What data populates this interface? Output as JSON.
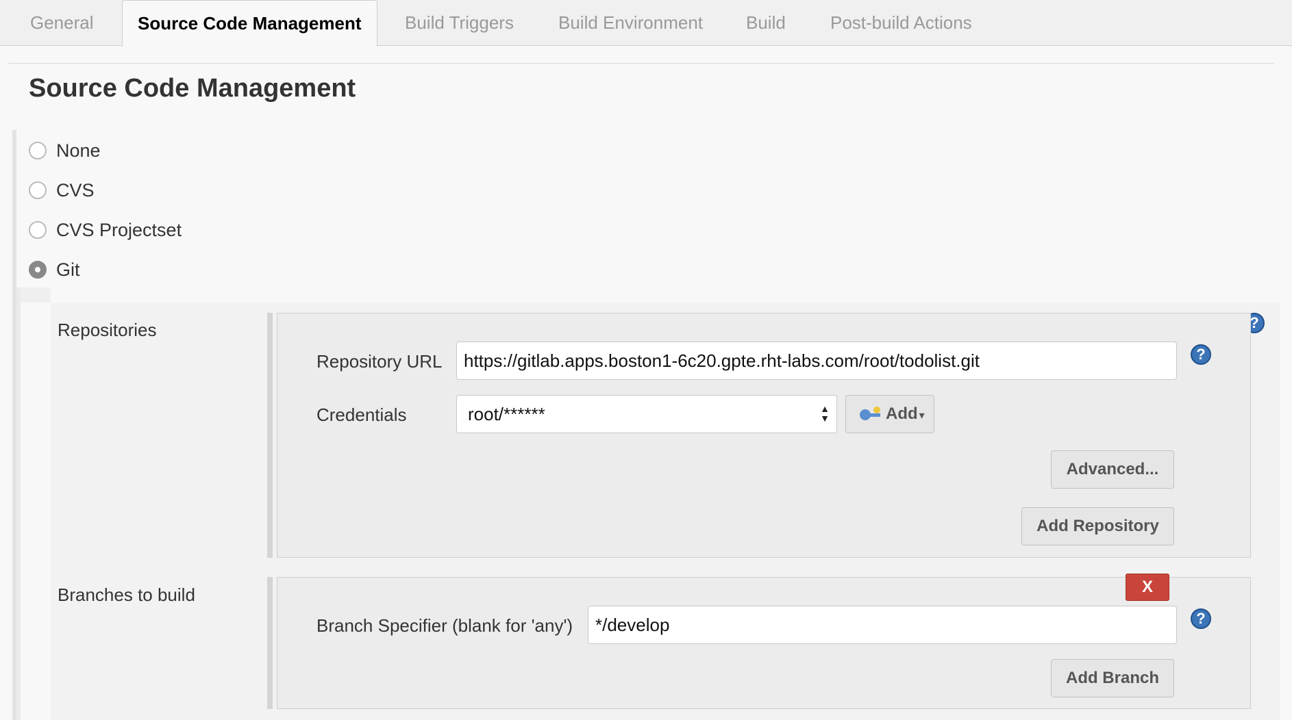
{
  "tabs": [
    {
      "label": "General",
      "active": false
    },
    {
      "label": "Source Code Management",
      "active": true
    },
    {
      "label": "Build Triggers",
      "active": false
    },
    {
      "label": "Build Environment",
      "active": false
    },
    {
      "label": "Build",
      "active": false
    },
    {
      "label": "Post-build Actions",
      "active": false
    }
  ],
  "section": {
    "title": "Source Code Management"
  },
  "scm_options": [
    {
      "label": "None",
      "checked": false
    },
    {
      "label": "CVS",
      "checked": false
    },
    {
      "label": "CVS Projectset",
      "checked": false
    },
    {
      "label": "Git",
      "checked": true
    }
  ],
  "repositories": {
    "label": "Repositories",
    "url_label": "Repository URL",
    "url_value": "https://gitlab.apps.boston1-6c20.gpte.rht-labs.com/root/todolist.git",
    "credentials_label": "Credentials",
    "credentials_value": "root/******",
    "add_label": "Add",
    "advanced_label": "Advanced...",
    "add_repository_label": "Add Repository"
  },
  "branches": {
    "label": "Branches to build",
    "delete_label": "X",
    "specifier_label": "Branch Specifier (blank for 'any')",
    "specifier_value": "*/develop",
    "add_branch_label": "Add Branch"
  },
  "help_glyph": "?",
  "colors": {
    "accent_help": "#3c74b8",
    "delete": "#c9443a"
  }
}
